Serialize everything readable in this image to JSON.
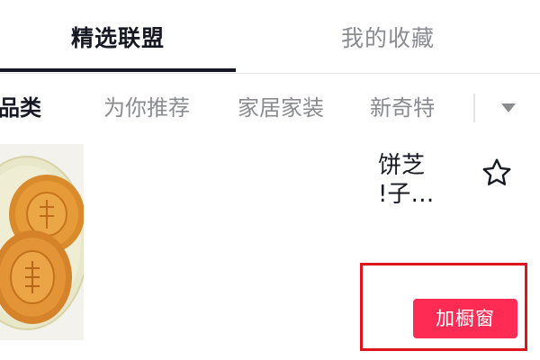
{
  "tabs": {
    "active_label": "精选联盟",
    "inactive_label": "我的收藏"
  },
  "categories": {
    "items": [
      "部品类",
      "为你推荐",
      "家居家装",
      "新奇特"
    ],
    "toggle_icon": "triangle-down-icon"
  },
  "product": {
    "title": "饼芝\n!子…",
    "favorite_icon": "star-outline-icon",
    "add_button_label": "加橱窗",
    "image_icon": "mooncake-image"
  },
  "colors": {
    "primary_text": "#161823",
    "secondary_text": "#8a8b91",
    "accent": "#fe2c55",
    "annotation_box": "#e0141d"
  }
}
